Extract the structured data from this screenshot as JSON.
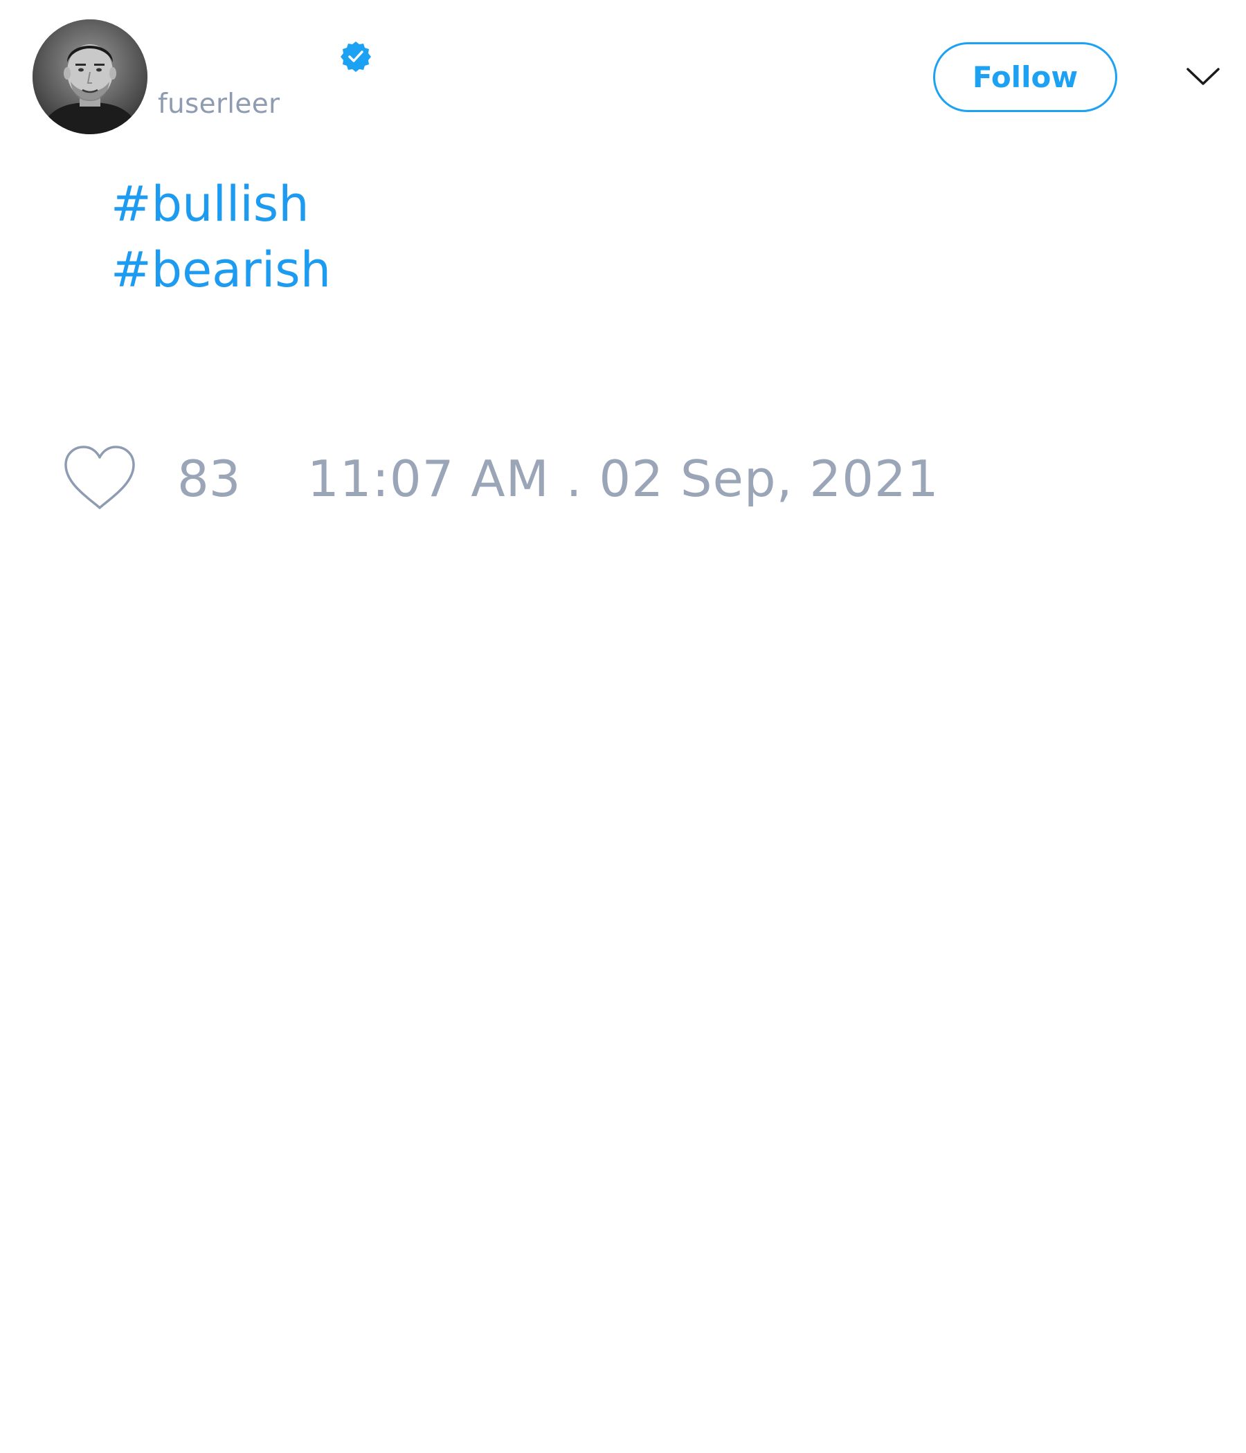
{
  "user": {
    "handle": "fuserleer",
    "verified": true,
    "avatar": "profile-photo"
  },
  "follow_button": {
    "label": "Follow"
  },
  "menu": {
    "icon": "chevron-down-icon"
  },
  "tweet": {
    "hashtags": [
      "#bullish",
      "#bearish"
    ]
  },
  "stats": {
    "like_icon": "heart-icon",
    "likes": "83",
    "timestamp": "11:07 AM . 02 Sep, 2021"
  },
  "colors": {
    "accent": "#1da1f2",
    "muted": "#9aa5b8",
    "background": "#ffffff"
  }
}
